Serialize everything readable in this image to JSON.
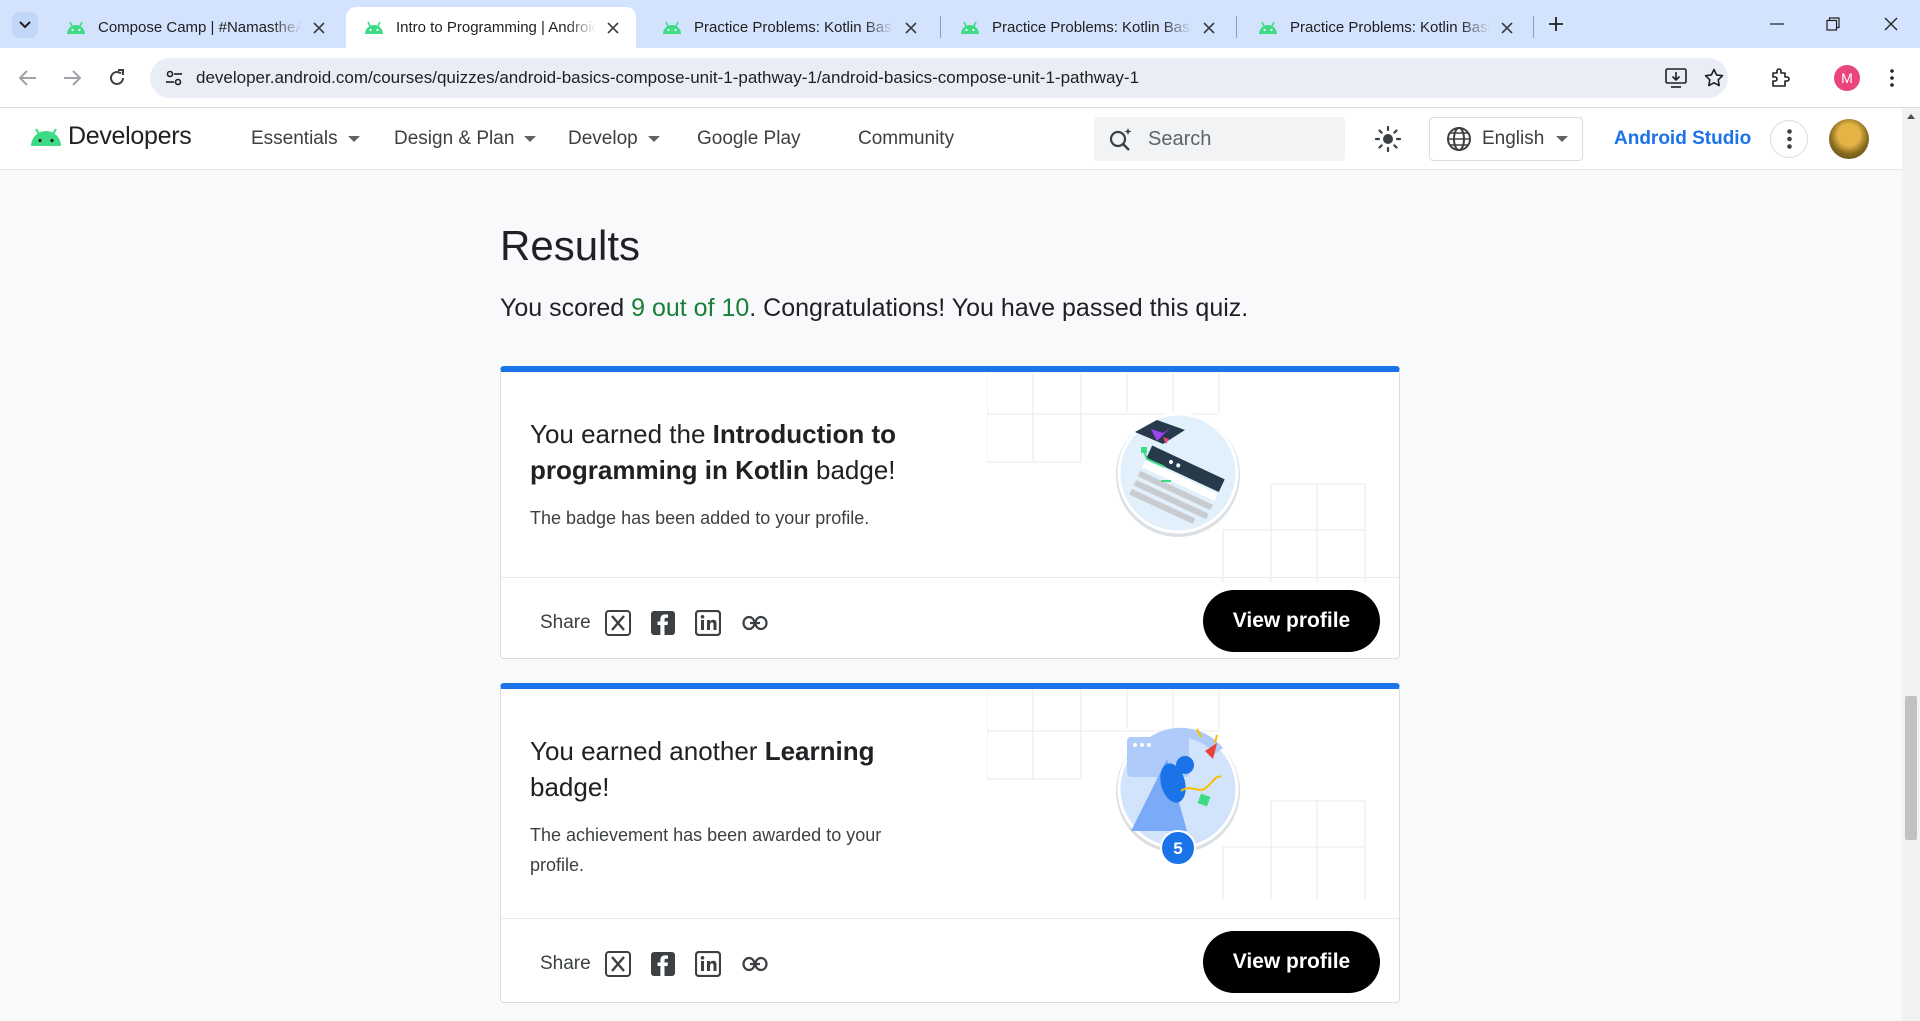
{
  "browser": {
    "tabs": [
      {
        "title": "Compose Camp | #NamastheAndroid",
        "active": false
      },
      {
        "title": "Intro to Programming | Android Developers",
        "active": true
      },
      {
        "title": "Practice Problems: Kotlin Basics",
        "active": false
      },
      {
        "title": "Practice Problems: Kotlin Basics",
        "active": false
      },
      {
        "title": "Practice Problems: Kotlin Basics",
        "active": false
      }
    ],
    "url": "developer.android.com/courses/quizzes/android-basics-compose-unit-1-pathway-1/android-basics-compose-unit-1-pathway-1",
    "profile_initial": "M"
  },
  "site": {
    "brand": "Developers",
    "nav": [
      "Essentials",
      "Design & Plan",
      "Develop",
      "Google Play",
      "Community"
    ],
    "search_placeholder": "Search",
    "language": "English",
    "android_studio": "Android Studio"
  },
  "results": {
    "title": "Results",
    "score_prefix": "You scored ",
    "score": "9 out of 10",
    "score_suffix": ". Congratulations! You have passed this quiz."
  },
  "cards": [
    {
      "headline_prefix": "You earned the ",
      "headline_bold": "Introduction to programming in Kotlin",
      "headline_suffix": " badge!",
      "description": "The badge has been added to your profile.",
      "share_label": "Share",
      "button": "View profile"
    },
    {
      "headline_prefix": "You earned another ",
      "headline_bold": "Learning",
      "headline_suffix": " badge!",
      "description": "The achievement has been awarded to your profile.",
      "share_label": "Share",
      "button": "View profile",
      "badge_count": "5"
    }
  ],
  "colors": {
    "accent": "#1a73e8",
    "score_green": "#188038",
    "android_green": "#3ddc84"
  }
}
